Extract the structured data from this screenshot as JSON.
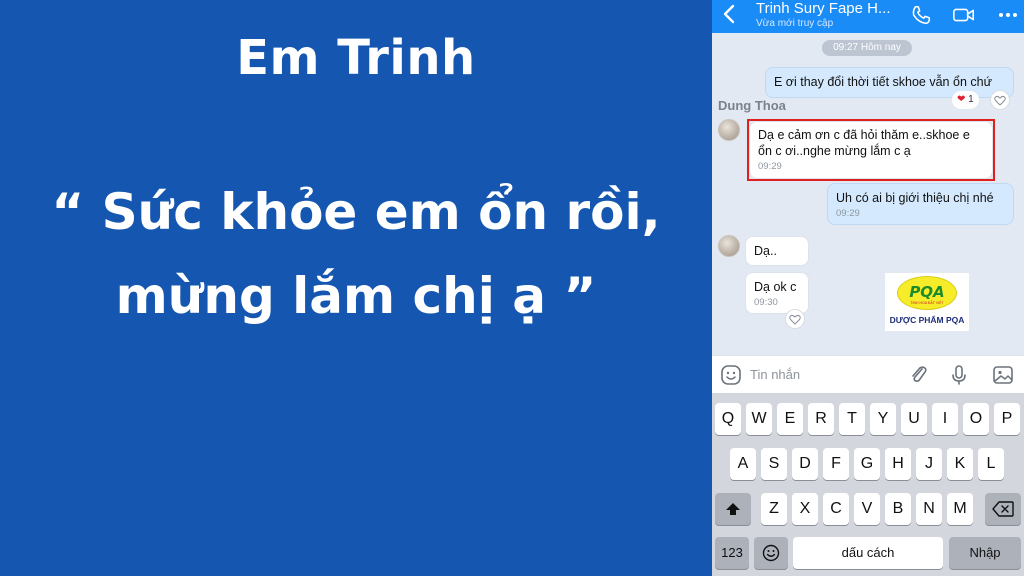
{
  "promo": {
    "name": "Em Trinh",
    "quote_line1": "“ Sức khỏe em ổn rồi,",
    "quote_line2": "mừng lắm chị ạ ”"
  },
  "chat_header": {
    "title": "Trinh Sury Fape H...",
    "status": "Vừa mới truy cập",
    "back_icon": "chevron-left-icon",
    "call_icon": "phone-icon",
    "video_icon": "video-icon",
    "more_icon": "more-icon",
    "color": "#1a8cf8"
  },
  "chat": {
    "time_chip": "09:27 Hôm nay",
    "sender_name": "Dung Thoa",
    "messages": [
      {
        "dir": "out",
        "text": "E ơi thay đổi thời tiết skhoe vẫn ổn chứ",
        "time": "",
        "reaction_count": "1"
      },
      {
        "dir": "in",
        "text_line1": "Dạ e cảm ơn c đã hỏi thăm e..skhoe e",
        "text_line2": "ổn c ơi..nghe mừng lắm c ạ",
        "time": "09:29",
        "highlight_color": "#e0201f"
      },
      {
        "dir": "out",
        "text": "Uh có ai bị giới thiệu chị nhé",
        "time": "09:29"
      },
      {
        "dir": "in",
        "text": "Dạ..",
        "time": ""
      },
      {
        "dir": "in",
        "text": "Dạ ok c",
        "time": "09:30"
      }
    ]
  },
  "logo": {
    "mark": "PQA",
    "tagline": "TINH HOA ĐẤT VIỆT",
    "brand": "DƯỢC PHẨM PQA"
  },
  "input": {
    "placeholder": "Tin nhắn",
    "emoji_icon": "emoji-icon",
    "attach_icon": "paperclip-icon",
    "mic_icon": "microphone-icon",
    "image_icon": "image-icon"
  },
  "keyboard": {
    "row1": [
      "Q",
      "W",
      "E",
      "R",
      "T",
      "Y",
      "U",
      "I",
      "O",
      "P"
    ],
    "row2": [
      "A",
      "S",
      "D",
      "F",
      "G",
      "H",
      "J",
      "K",
      "L"
    ],
    "row3": [
      "Z",
      "X",
      "C",
      "V",
      "B",
      "N",
      "M"
    ],
    "numbers_key": "123",
    "space_key": "dấu cách",
    "return_key": "Nhập",
    "shift_icon": "shift-icon",
    "backspace_icon": "backspace-icon",
    "emoji_key_icon": "emoji-icon"
  }
}
